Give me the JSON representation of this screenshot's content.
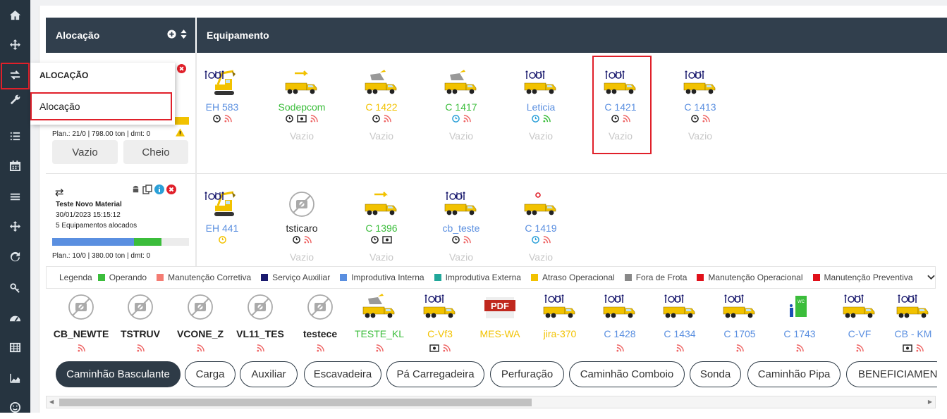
{
  "sidebar": {
    "icons": [
      "home-icon",
      "move-icon",
      "transfer-icon",
      "wrench-icon",
      "list-icon",
      "calendar-icon",
      "menu-icon",
      "move-icon",
      "refresh-icon",
      "key-icon",
      "dashboard-icon",
      "table-icon",
      "chart-area-icon",
      "smile-icon"
    ]
  },
  "header": {
    "alloc_title": "Alocação",
    "equip_title": "Equipamento"
  },
  "menu": {
    "heading": "ALOCAÇÃO",
    "item": "Alocação"
  },
  "allocation1": {
    "plan": "Plan.: 21/0 | 798.00 ton | dmt: 0",
    "btn_empty": "Vazio",
    "btn_full": "Cheio"
  },
  "allocation2": {
    "title": "Teste Novo Material",
    "datetime": "30/01/2023 15:15:12",
    "count": "5 Equipamentos alocados",
    "plan": "Plan.: 10/0 | 380.00 ton | dmt: 0"
  },
  "row1": [
    {
      "name": "EH 583",
      "color": "blue",
      "state": ""
    },
    {
      "name": "Sodepcom",
      "color": "green",
      "state": "Vazio"
    },
    {
      "name": "C 1422",
      "color": "yellow",
      "state": "Vazio"
    },
    {
      "name": "C 1417",
      "color": "green",
      "state": "Vazio"
    },
    {
      "name": "Leticia",
      "color": "blue",
      "state": "Vazio"
    },
    {
      "name": "C 1421",
      "color": "blue",
      "state": "Vazio"
    },
    {
      "name": "C 1413",
      "color": "blue",
      "state": "Vazio"
    }
  ],
  "row2": [
    {
      "name": "EH 441",
      "color": "blue",
      "state": ""
    },
    {
      "name": "tsticaro",
      "color": "dark",
      "state": "Vazio"
    },
    {
      "name": "C 1396",
      "color": "green",
      "state": "Vazio"
    },
    {
      "name": "cb_teste",
      "color": "blue",
      "state": "Vazio"
    },
    {
      "name": "C 1419",
      "color": "blue",
      "state": "Vazio"
    }
  ],
  "legend": {
    "label": "Legenda",
    "items": [
      {
        "label": "Operando",
        "color": "#3bbd3b"
      },
      {
        "label": "Manutenção Corretiva",
        "color": "#f47c73"
      },
      {
        "label": "Serviço Auxiliar",
        "color": "#1a1a6e"
      },
      {
        "label": "Improdutiva Interna",
        "color": "#5a8fe0"
      },
      {
        "label": "Improdutiva Externa",
        "color": "#21a79a"
      },
      {
        "label": "Atraso Operacional",
        "color": "#f2c200"
      },
      {
        "label": "Fora de Frota",
        "color": "#888888"
      },
      {
        "label": "Manutenção Operacional",
        "color": "#e0101a"
      },
      {
        "label": "Manutenção Preventiva",
        "color": "#e0101a"
      }
    ]
  },
  "pool": [
    {
      "name": "CB_NEWTE",
      "color": "dark",
      "pic": "nophoto"
    },
    {
      "name": "TSTRUV",
      "color": "dark",
      "pic": "nophoto"
    },
    {
      "name": "VCONE_Z",
      "color": "dark",
      "pic": "nophoto"
    },
    {
      "name": "VL11_TES",
      "color": "dark",
      "pic": "nophoto"
    },
    {
      "name": "testece",
      "color": "dark",
      "pic": "nophoto"
    },
    {
      "name": "TESTE_KL",
      "color": "green",
      "pic": "dump"
    },
    {
      "name": "C-Vf3",
      "color": "yellow",
      "pic": "truck"
    },
    {
      "name": "MES-WA",
      "color": "yellow",
      "pic": "pdf"
    },
    {
      "name": "jira-370",
      "color": "yellow",
      "pic": "truck"
    },
    {
      "name": "C 1428",
      "color": "blue",
      "pic": "truck"
    },
    {
      "name": "C 1434",
      "color": "blue",
      "pic": "truck"
    },
    {
      "name": "C 1705",
      "color": "blue",
      "pic": "truck"
    },
    {
      "name": "C 1743",
      "color": "blue",
      "pic": "wc"
    },
    {
      "name": "C-VF",
      "color": "blue",
      "pic": "truck"
    },
    {
      "name": "CB - KM",
      "color": "blue",
      "pic": "truck"
    }
  ],
  "pdf_label": "PDF",
  "chips": [
    "Caminhão Basculante",
    "Carga",
    "Auxiliar",
    "Escavadeira",
    "Pá Carregadeira",
    "Perfuração",
    "Caminhão Comboio",
    "Sonda",
    "Caminhão Pipa",
    "BENEFICIAMENTO"
  ]
}
